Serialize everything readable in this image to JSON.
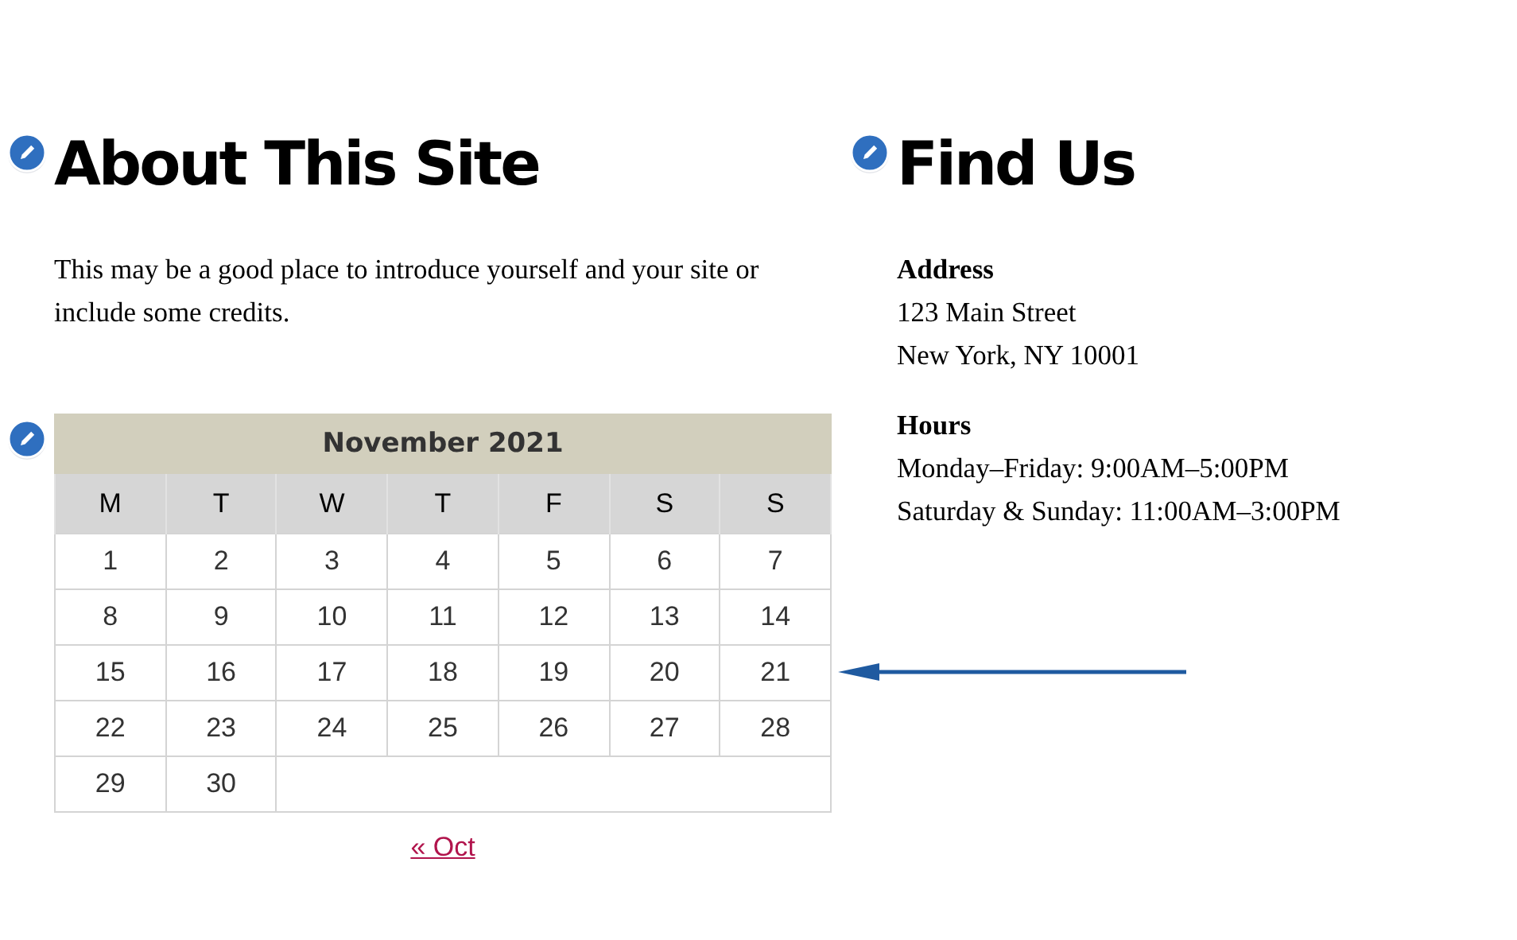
{
  "about": {
    "title": "About This Site",
    "text": "This may be a good place to introduce yourself and your site or include some credits."
  },
  "calendar": {
    "caption": "November 2021",
    "weekdays": [
      "M",
      "T",
      "W",
      "T",
      "F",
      "S",
      "S"
    ],
    "weeks": [
      [
        "1",
        "2",
        "3",
        "4",
        "5",
        "6",
        "7"
      ],
      [
        "8",
        "9",
        "10",
        "11",
        "12",
        "13",
        "14"
      ],
      [
        "15",
        "16",
        "17",
        "18",
        "19",
        "20",
        "21"
      ],
      [
        "22",
        "23",
        "24",
        "25",
        "26",
        "27",
        "28"
      ],
      [
        "29",
        "30"
      ]
    ],
    "prev_link": "« Oct"
  },
  "find_us": {
    "title": "Find Us",
    "sections": [
      {
        "heading": "Address",
        "lines": [
          "123 Main Street",
          "New York, NY 10001"
        ]
      },
      {
        "heading": "Hours",
        "lines": [
          "Monday–Friday: 9:00AM–5:00PM",
          "Saturday & Sunday: 11:00AM–3:00PM"
        ]
      }
    ]
  }
}
